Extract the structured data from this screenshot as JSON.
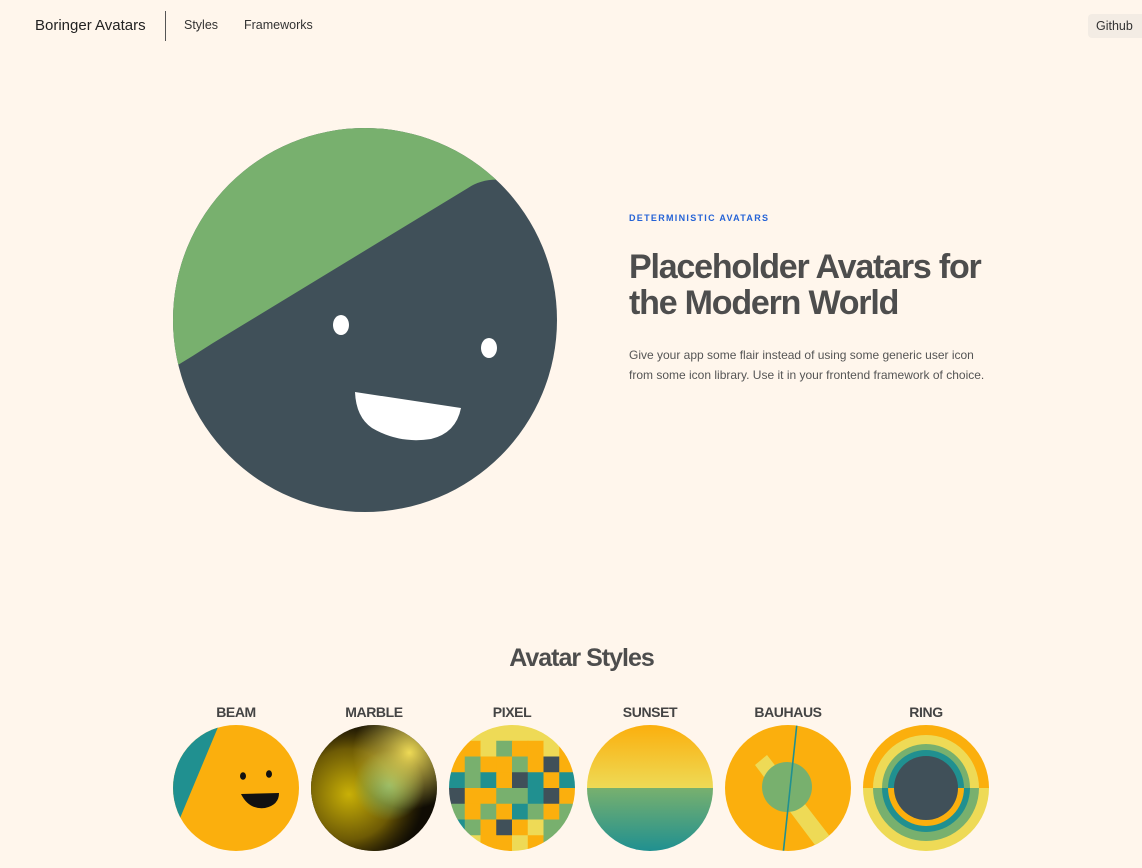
{
  "header": {
    "brand": "Boringer Avatars",
    "nav": [
      "Styles",
      "Frameworks"
    ],
    "github": "Github"
  },
  "hero": {
    "eyebrow": "DETERMINISTIC AVATARS",
    "title": "Placeholder Avatars for the Modern World",
    "description": "Give your app some flair instead of using some generic user icon from some icon library. Use it in your frontend framework of choice."
  },
  "styles_section": {
    "title": "Avatar Styles",
    "styles": [
      "BEAM",
      "MARBLE",
      "PIXEL",
      "SUNSET",
      "BAUHAUS",
      "RING"
    ]
  },
  "colors": {
    "background": "#fff6ec",
    "accent": "#2563d6",
    "palette": [
      "#405059",
      "#78b06e",
      "#fbaf0d",
      "#eeda56",
      "#209090"
    ]
  }
}
